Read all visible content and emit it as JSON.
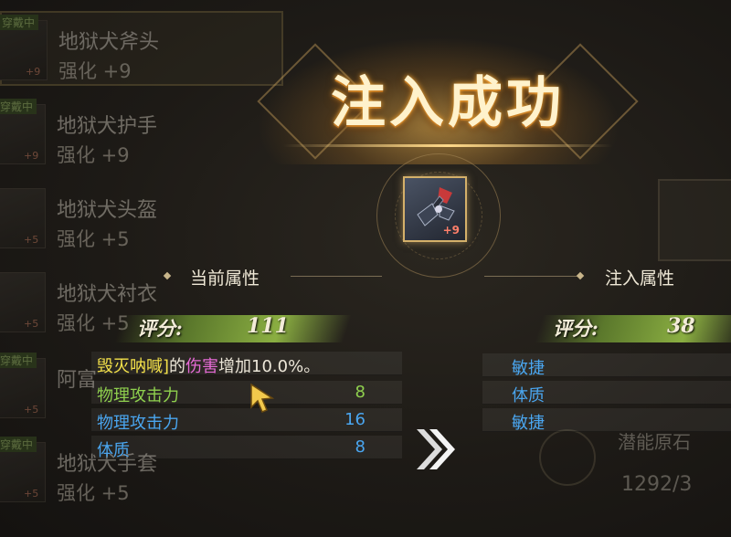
{
  "background_list": [
    {
      "tag": "穿戴中",
      "plus": "+9",
      "name": "地狱犬斧头",
      "enhance": "强化 +9",
      "selected": true
    },
    {
      "tag": "穿戴中",
      "plus": "+9",
      "name": "地狱犬护手",
      "enhance": "强化 +9",
      "selected": false
    },
    {
      "tag": "",
      "plus": "+5",
      "name": "地狱犬头盔",
      "enhance": "强化 +5",
      "selected": false
    },
    {
      "tag": "",
      "plus": "+5",
      "name": "地狱犬衬衣",
      "enhance": "强化 +5",
      "selected": false
    },
    {
      "tag": "穿戴中",
      "plus": "+5",
      "name": "阿富",
      "enhance": "",
      "selected": false
    },
    {
      "tag": "穿戴中",
      "plus": "+5",
      "name": "地狱犬手套",
      "enhance": "强化 +5",
      "selected": false
    }
  ],
  "background_right": {
    "name": "潜能原石",
    "count": "1292/3"
  },
  "title": "注入成功",
  "item": {
    "plus": "+9",
    "icon": "axe-weapon-icon"
  },
  "current": {
    "header": "当前属性",
    "score_label": "评分:",
    "score_value": "111",
    "effect": {
      "skill_fragment": "毁灭呐喊]",
      "mid": "的",
      "keyword": "伤害",
      "tail": "增加10.0%。"
    },
    "attributes": [
      {
        "name": "物理攻击力",
        "value": "8",
        "color": "#8fd04e"
      },
      {
        "name": "物理攻击力",
        "value": "16",
        "color": "#4aa6f0"
      },
      {
        "name": "体质",
        "value": "8",
        "color": "#4aa6f0"
      }
    ]
  },
  "injected": {
    "header": "注入属性",
    "score_label": "评分:",
    "score_value": "38",
    "attributes": [
      {
        "name": "敏捷"
      },
      {
        "name": "体质"
      },
      {
        "name": "敏捷"
      }
    ]
  },
  "colors": {
    "gold": "#d4b06a",
    "green": "#8fd04e",
    "blue": "#4aa6f0",
    "pink": "#e66bd6",
    "yellow": "#f5e24a"
  }
}
